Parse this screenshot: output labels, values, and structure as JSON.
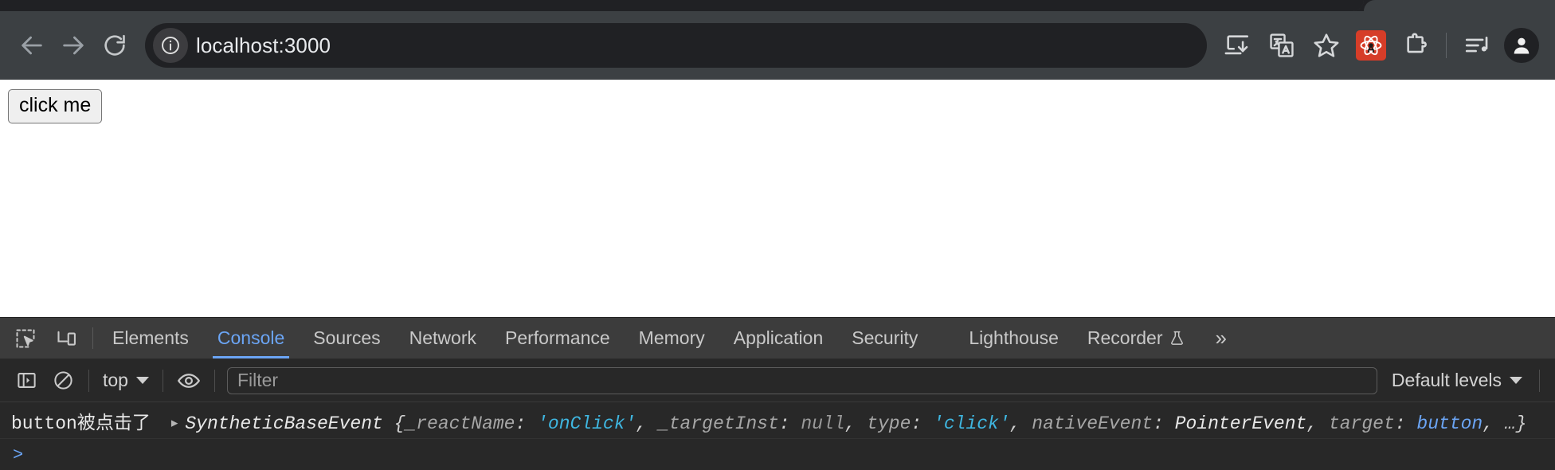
{
  "browser": {
    "nav": {
      "back_label": "Back",
      "forward_label": "Forward",
      "reload_label": "Reload"
    },
    "omnibox": {
      "site_info_icon": "info-circle-icon",
      "url": "localhost:3000"
    },
    "toolbar_icons": [
      {
        "name": "install-app-icon",
        "label": "Install page as app"
      },
      {
        "name": "translate-icon",
        "label": "Translate this page"
      },
      {
        "name": "bookmark-star-icon",
        "label": "Bookmark this tab"
      },
      {
        "name": "react-devtools-extension-icon",
        "label": "React Developer Tools",
        "color": "#d63d28"
      },
      {
        "name": "extensions-puzzle-icon",
        "label": "Extensions"
      },
      {
        "name": "media-playlist-icon",
        "label": "Media controls"
      },
      {
        "name": "profile-avatar-icon",
        "label": "Profile"
      }
    ]
  },
  "page": {
    "button_label": "click me"
  },
  "devtools": {
    "left_icons": [
      {
        "name": "inspect-element-icon",
        "label": "Inspect element"
      },
      {
        "name": "device-toolbar-icon",
        "label": "Toggle device toolbar"
      }
    ],
    "tabs": [
      {
        "label": "Elements",
        "active": false
      },
      {
        "label": "Console",
        "active": true
      },
      {
        "label": "Sources",
        "active": false
      },
      {
        "label": "Network",
        "active": false
      },
      {
        "label": "Performance",
        "active": false
      },
      {
        "label": "Memory",
        "active": false
      },
      {
        "label": "Application",
        "active": false
      },
      {
        "label": "Security",
        "active": false
      },
      {
        "label": "Lighthouse",
        "active": false
      },
      {
        "label": "Recorder",
        "active": false,
        "icon": "experiment-flask-icon"
      }
    ],
    "more_tabs_label": "»",
    "console_toolbar": {
      "sidebar_toggle_icon": "console-sidebar-icon",
      "clear_console_icon": "clear-console-icon",
      "context_value": "top",
      "eye_icon": "live-expression-eye-icon",
      "filter_placeholder": "Filter",
      "filter_value": "",
      "levels_value": "Default levels"
    },
    "console_log": {
      "message": "button被点击了",
      "expand_arrow": "▸",
      "object_constructor": "SyntheticBaseEvent",
      "open_brace": "{",
      "entries": [
        {
          "key": "_reactName",
          "sep": ": ",
          "value": "'onClick'",
          "type": "string"
        },
        {
          "key": "_targetInst",
          "sep": ": ",
          "value": "null",
          "type": "null"
        },
        {
          "key": "type",
          "sep": ": ",
          "value": "'click'",
          "type": "string"
        },
        {
          "key": "nativeEvent",
          "sep": ": ",
          "value": "PointerEvent",
          "type": "ctor"
        },
        {
          "key": "target",
          "sep": ": ",
          "value": "button",
          "type": "node"
        }
      ],
      "ellipsis": "…",
      "close_brace": "}",
      "separator": ", "
    },
    "prompt_chevron": ">"
  }
}
